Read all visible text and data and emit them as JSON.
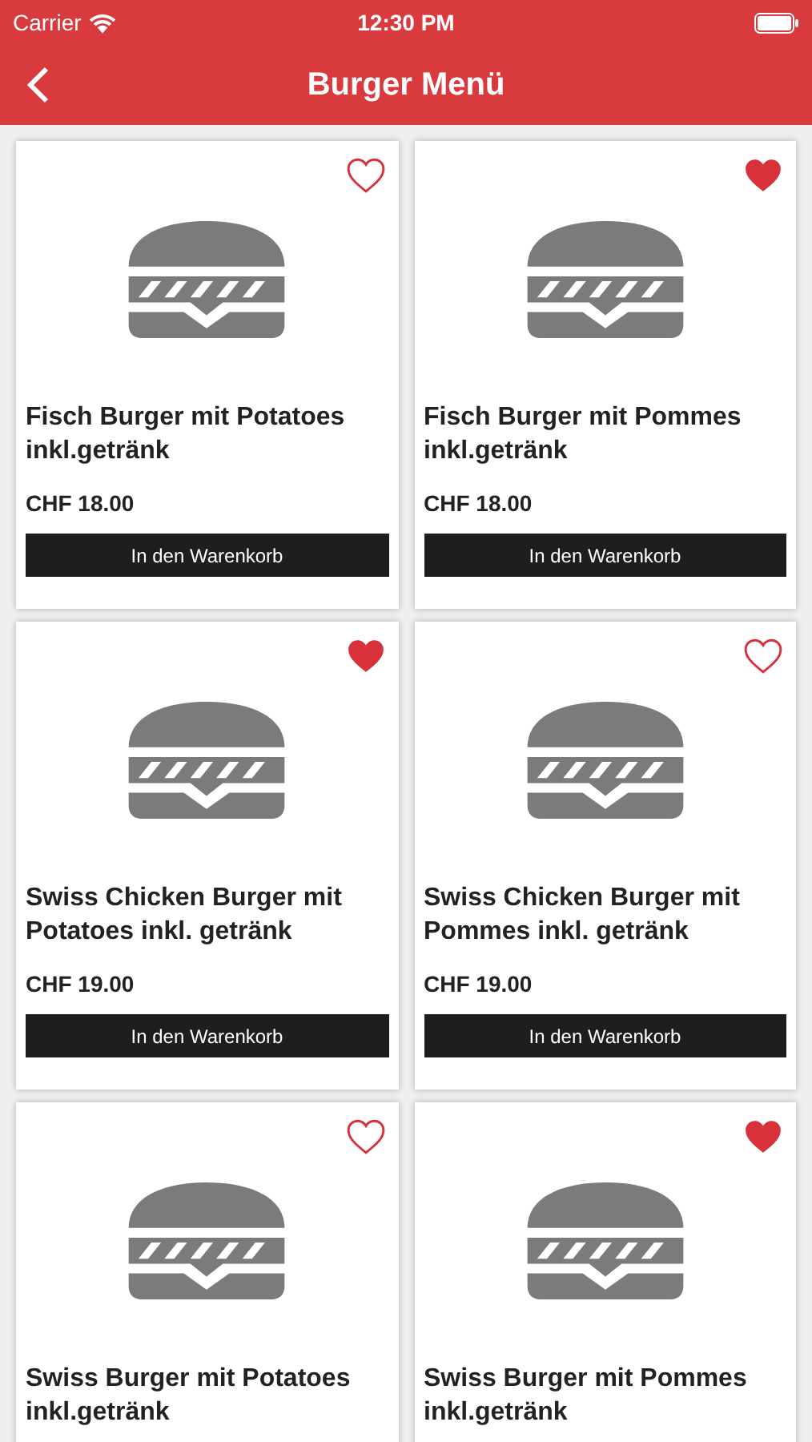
{
  "status_bar": {
    "carrier": "Carrier",
    "time": "12:30 PM"
  },
  "nav": {
    "title": "Burger Menü"
  },
  "products": [
    {
      "name": "Fisch Burger mit Potatoes inkl.getränk",
      "price": "CHF 18.00",
      "button": "In den Warenkorb",
      "favorite": false
    },
    {
      "name": "Fisch Burger mit Pommes inkl.getränk",
      "price": "CHF 18.00",
      "button": "In den Warenkorb",
      "favorite": true
    },
    {
      "name": "Swiss Chicken Burger mit Potatoes inkl. getränk",
      "price": "CHF 19.00",
      "button": "In den Warenkorb",
      "favorite": true
    },
    {
      "name": "Swiss Chicken Burger mit Pommes inkl. getränk",
      "price": "CHF 19.00",
      "button": "In den Warenkorb",
      "favorite": false
    },
    {
      "name": "Swiss Burger mit Potatoes inkl.getränk",
      "favorite": false
    },
    {
      "name": "Swiss Burger mit Pommes inkl.getränk",
      "favorite": true
    }
  ]
}
